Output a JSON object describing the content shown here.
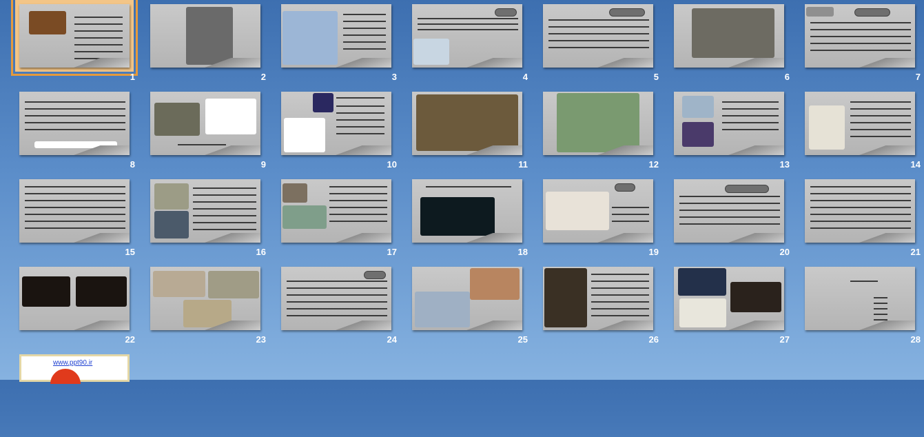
{
  "app": {
    "view": "Slide Sorter"
  },
  "slides": [
    {
      "number": "1",
      "selected": true
    },
    {
      "number": "2"
    },
    {
      "number": "3"
    },
    {
      "number": "4"
    },
    {
      "number": "5"
    },
    {
      "number": "6"
    },
    {
      "number": "7"
    },
    {
      "number": "8"
    },
    {
      "number": "9"
    },
    {
      "number": "10"
    },
    {
      "number": "11"
    },
    {
      "number": "12"
    },
    {
      "number": "13"
    },
    {
      "number": "14"
    },
    {
      "number": "15"
    },
    {
      "number": "16"
    },
    {
      "number": "17"
    },
    {
      "number": "18"
    },
    {
      "number": "19"
    },
    {
      "number": "20"
    },
    {
      "number": "21"
    },
    {
      "number": "22"
    },
    {
      "number": "23"
    },
    {
      "number": "24"
    },
    {
      "number": "25"
    },
    {
      "number": "26"
    },
    {
      "number": "27"
    },
    {
      "number": "28"
    }
  ],
  "last_slide": {
    "link_text": "www.ppt90.ir"
  },
  "colors": {
    "background": "#5b8dc9",
    "selection": "#e59a3c",
    "slide_number": "#ffffff"
  }
}
